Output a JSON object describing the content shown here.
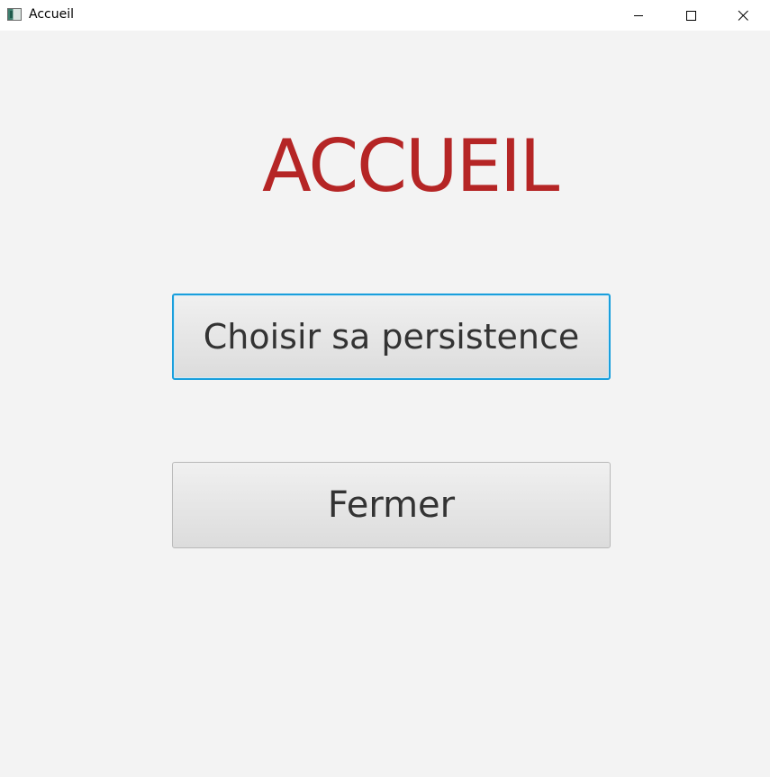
{
  "window": {
    "title": "Accueil",
    "app_icon": "java-app-icon",
    "controls": {
      "minimize_icon": "minimize-icon",
      "maximize_icon": "maximize-icon",
      "close_icon": "close-icon"
    }
  },
  "main": {
    "heading": "ACCUEIL",
    "buttons": [
      {
        "label": "Choisir sa persistence",
        "focused": true
      },
      {
        "label": "Fermer",
        "focused": false
      }
    ]
  },
  "colors": {
    "heading": "#b52525",
    "focus_border": "#1a9fdc",
    "background": "#f3f3f3",
    "button_text": "#333333"
  }
}
